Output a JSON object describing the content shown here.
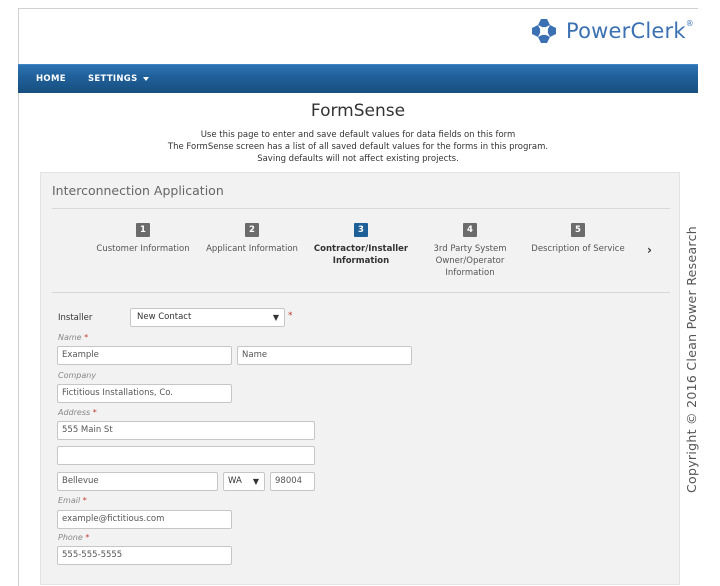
{
  "brand": {
    "name": "PowerClerk",
    "reg": "®"
  },
  "nav": {
    "home": "HOME",
    "settings": "SETTINGS"
  },
  "page": {
    "title": "FormSense",
    "desc1": "Use this page to enter and save default values for data fields on this form",
    "desc2": "The FormSense screen has a list of all saved default values for the forms in this program.",
    "desc3": "Saving defaults will not affect existing projects."
  },
  "panel": {
    "title": "Interconnection Application"
  },
  "steps": [
    {
      "num": "1",
      "label": "Customer Information"
    },
    {
      "num": "2",
      "label": "Applicant Information"
    },
    {
      "num": "3",
      "label": "Contractor/Installer Information"
    },
    {
      "num": "4",
      "label": "3rd Party System Owner/Operator Information"
    },
    {
      "num": "5",
      "label": "Description of Service"
    }
  ],
  "form": {
    "installer_label": "Installer",
    "installer_value": "New Contact",
    "name_label": "Name",
    "first_name": "Example",
    "last_name_placeholder": "Name",
    "company_label": "Company",
    "company": "Fictitious Installations, Co.",
    "address_label": "Address",
    "address1": "555 Main St",
    "address2": "",
    "city": "Bellevue",
    "state": "WA",
    "zip": "98004",
    "email_label": "Email",
    "email": "example@fictitious.com",
    "phone_label": "Phone",
    "phone": "555-555-5555",
    "required_mark": "*"
  },
  "copyright": "Copyright © 2016 Clean Power Research",
  "colors": {
    "nav": "#1f5f98",
    "brand": "#3b70b3",
    "active_step": "#1f5f98"
  }
}
